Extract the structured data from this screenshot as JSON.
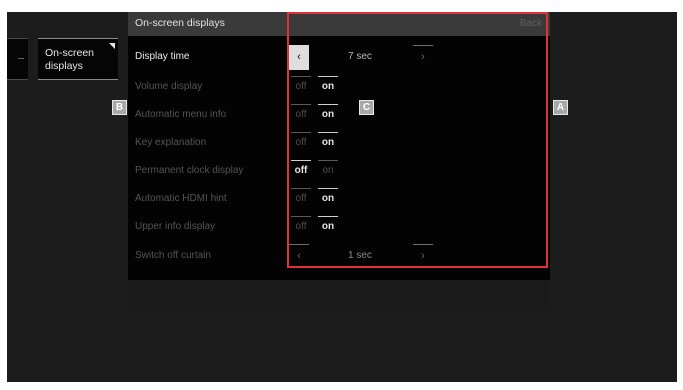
{
  "breadcrumb": {
    "label": "On-screen displays"
  },
  "menu": {
    "title": "On-screen displays",
    "back_label": "Back"
  },
  "rows": [
    {
      "label": "Display time",
      "type": "stepper",
      "value": "7 sec",
      "prev_glyph": "‹",
      "next_glyph": "›"
    },
    {
      "label": "Volume display",
      "type": "toggle",
      "off": "off",
      "on": "on",
      "selected": "on"
    },
    {
      "label": "Automatic menu info",
      "type": "toggle",
      "off": "off",
      "on": "on",
      "selected": "on"
    },
    {
      "label": "Key explanation",
      "type": "toggle",
      "off": "off",
      "on": "on",
      "selected": "on"
    },
    {
      "label": "Permanent clock display",
      "type": "toggle",
      "off": "off",
      "on": "on",
      "selected": "off"
    },
    {
      "label": "Automatic HDMI hint",
      "type": "toggle",
      "off": "off",
      "on": "on",
      "selected": "on"
    },
    {
      "label": "Upper info display",
      "type": "toggle",
      "off": "off",
      "on": "on",
      "selected": "on"
    },
    {
      "label": "Switch off curtain",
      "type": "stepper",
      "value": "1 sec",
      "prev_glyph": "‹",
      "next_glyph": "›"
    }
  ],
  "callouts": {
    "a": "A",
    "b": "B",
    "c": "C"
  },
  "colors": {
    "highlight_frame": "#e03136",
    "panel_background": "#030303",
    "header_background": "#3a3a3a"
  }
}
